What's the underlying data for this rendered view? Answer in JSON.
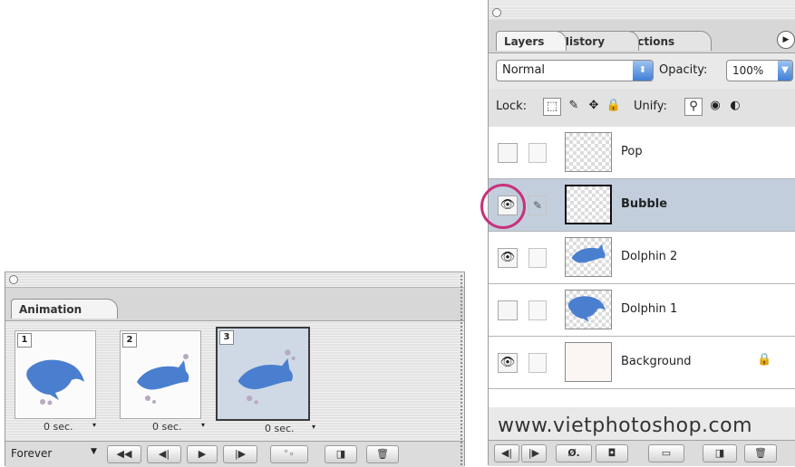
{
  "animation_panel": {
    "tab_label": "Animation",
    "frames": [
      {
        "number": "1",
        "delay": "0 sec.",
        "selected": false
      },
      {
        "number": "2",
        "delay": "0 sec.",
        "selected": false
      },
      {
        "number": "3",
        "delay": "0 sec.",
        "selected": true
      }
    ],
    "loop_label": "Forever",
    "toolbar_icons": [
      "first-frame-icon",
      "previous-frame-icon",
      "play-icon",
      "next-frame-icon",
      "tween-icon",
      "duplicate-frame-icon",
      "trash-icon"
    ]
  },
  "layers_panel": {
    "tabs": [
      "Layers",
      "History",
      "Actions"
    ],
    "blend_mode": "Normal",
    "opacity_label": "Opacity:",
    "opacity_value": "100%",
    "lock_label": "Lock:",
    "unify_label": "Unify:",
    "layers": [
      {
        "name": "Pop",
        "visible": false,
        "selected": false,
        "thumb": "transparent"
      },
      {
        "name": "Bubble",
        "visible": true,
        "selected": true,
        "thumb": "transparent"
      },
      {
        "name": "Dolphin 2",
        "visible": true,
        "selected": false,
        "thumb": "dolphin"
      },
      {
        "name": "Dolphin 1",
        "visible": false,
        "selected": false,
        "thumb": "dolphin"
      },
      {
        "name": "Background",
        "visible": true,
        "selected": false,
        "thumb": "plain",
        "locked": true
      }
    ],
    "watermark": "www.vietphotoshop.com"
  },
  "colors": {
    "dolphin": "#4a7fd0",
    "selection_row": "#c3cedd",
    "highlight_circle": "#c9317b",
    "select_arrow": "#3f7fd6"
  }
}
